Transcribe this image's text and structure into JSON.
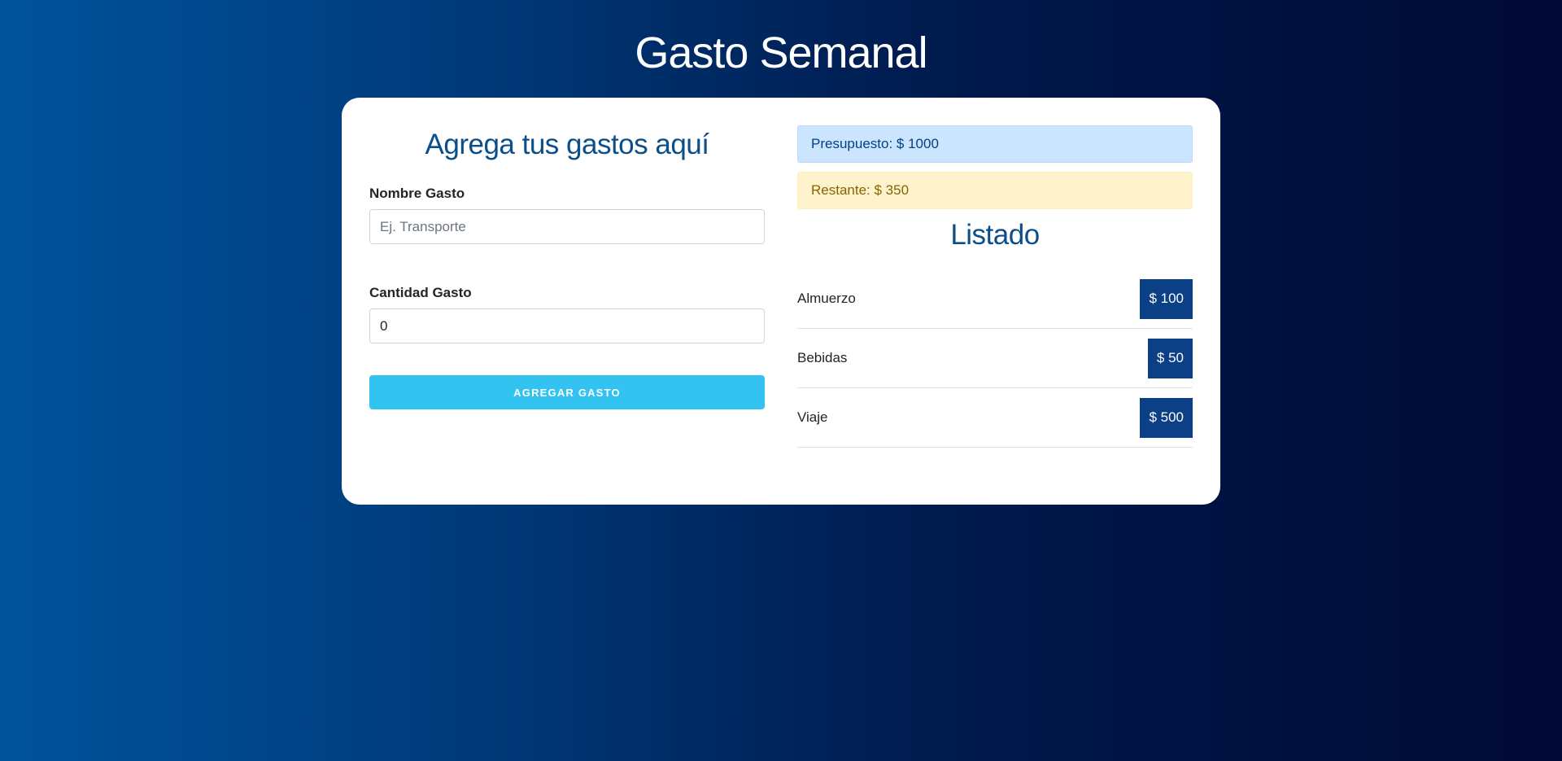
{
  "header": {
    "title": "Gasto Semanal"
  },
  "form": {
    "heading": "Agrega tus gastos aquí",
    "name_field": {
      "label": "Nombre Gasto",
      "placeholder": "Ej. Transporte",
      "value": ""
    },
    "amount_field": {
      "label": "Cantidad Gasto",
      "value": "0"
    },
    "submit_label": "Agregar Gasto"
  },
  "summary": {
    "budget": {
      "label": "Presupuesto:",
      "amount": "$ 1000"
    },
    "remaining": {
      "label": "Restante:",
      "amount": "$ 350"
    }
  },
  "list": {
    "heading": "Listado",
    "items": [
      {
        "name": "Almuerzo",
        "amount": "$ 100"
      },
      {
        "name": "Bebidas",
        "amount": "$ 50"
      },
      {
        "name": "Viaje",
        "amount": "$ 500"
      }
    ]
  },
  "colors": {
    "accent": "#33c3f0",
    "heading": "#0b4f8a",
    "badge": "#0b3f86",
    "budget_bg": "#cce5ff",
    "remaining_bg": "#fff3cd"
  }
}
